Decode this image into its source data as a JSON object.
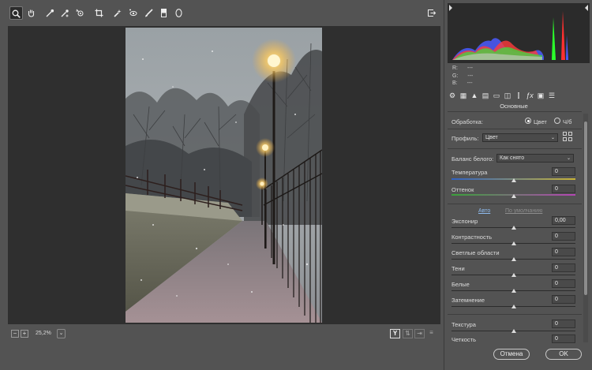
{
  "toolbar": {
    "tools": [
      "zoom-icon",
      "hand-icon",
      "white-balance-icon",
      "color-sampler-icon",
      "targeted-adjust-icon",
      "crop-icon",
      "spot-removal-icon",
      "red-eye-icon",
      "adjustment-brush-icon",
      "graduated-filter-icon",
      "radial-filter-icon"
    ],
    "active_tool": "zoom-icon",
    "open_icon": "export-icon"
  },
  "rgb": {
    "r_label": "R:",
    "g_label": "G:",
    "b_label": "B:",
    "r_value": "---",
    "g_value": "---",
    "b_value": "---"
  },
  "status": {
    "zoom_minus": "−",
    "zoom_plus": "+",
    "zoom_value": "25,2%",
    "zoom_dropdown": "⌄",
    "before_after": "Y"
  },
  "panel": {
    "section_title": "Основные",
    "processing_label": "Обработка:",
    "processing_options": [
      "Цвет",
      "Ч/б"
    ],
    "processing_selected": "Цвет",
    "profile_label": "Профиль:",
    "profile_value": "Цвет",
    "wb_label": "Баланс белого:",
    "wb_value": "Как снято",
    "sliders": [
      {
        "label": "Температура",
        "value": "0",
        "level": 0.5
      },
      {
        "label": "Оттенок",
        "value": "0",
        "level": 0.5
      },
      {
        "label": "Экспонир",
        "value": "0,00",
        "level": 0.5
      },
      {
        "label": "Контрастность",
        "value": "0",
        "level": 0.5
      },
      {
        "label": "Светлые области",
        "value": "0",
        "level": 0.5
      },
      {
        "label": "Тени",
        "value": "0",
        "level": 0.5
      },
      {
        "label": "Белые",
        "value": "0",
        "level": 0.5
      },
      {
        "label": "Затемнение",
        "value": "0",
        "level": 0.5
      },
      {
        "label": "Текстура",
        "value": "0",
        "level": 0.5
      },
      {
        "label": "Четкость",
        "value": "0",
        "level": 0.5
      }
    ],
    "auto_label": "Авто",
    "default_label": "По умолчанию"
  },
  "buttons": {
    "cancel": "Отмена",
    "ok": "OK"
  },
  "colors": {
    "panel_bg": "#535353",
    "canvas_bg": "#2f2f2f",
    "histogram_bg": "#2b2b2b",
    "temperature_start": "#2f62c4",
    "temperature_end": "#c8b437",
    "tint_start": "#3aa13a",
    "tint_end": "#b445b4",
    "link_active": "#8fbcf0",
    "link_disabled": "#8e8e8e"
  }
}
